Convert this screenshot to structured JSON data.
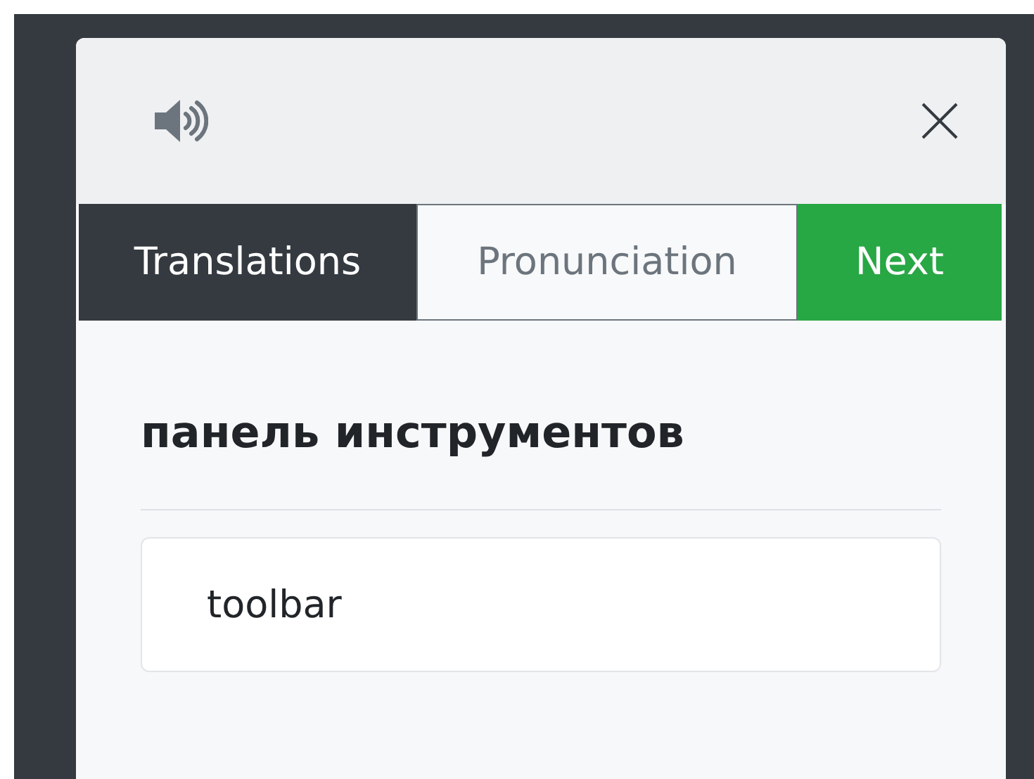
{
  "tabs": [
    {
      "label": "Translations",
      "selected": true
    },
    {
      "label": "Pronunciation",
      "selected": false
    }
  ],
  "next_button": {
    "label": "Next"
  },
  "word": "панель инструментов",
  "translations": [
    "toolbar"
  ]
}
